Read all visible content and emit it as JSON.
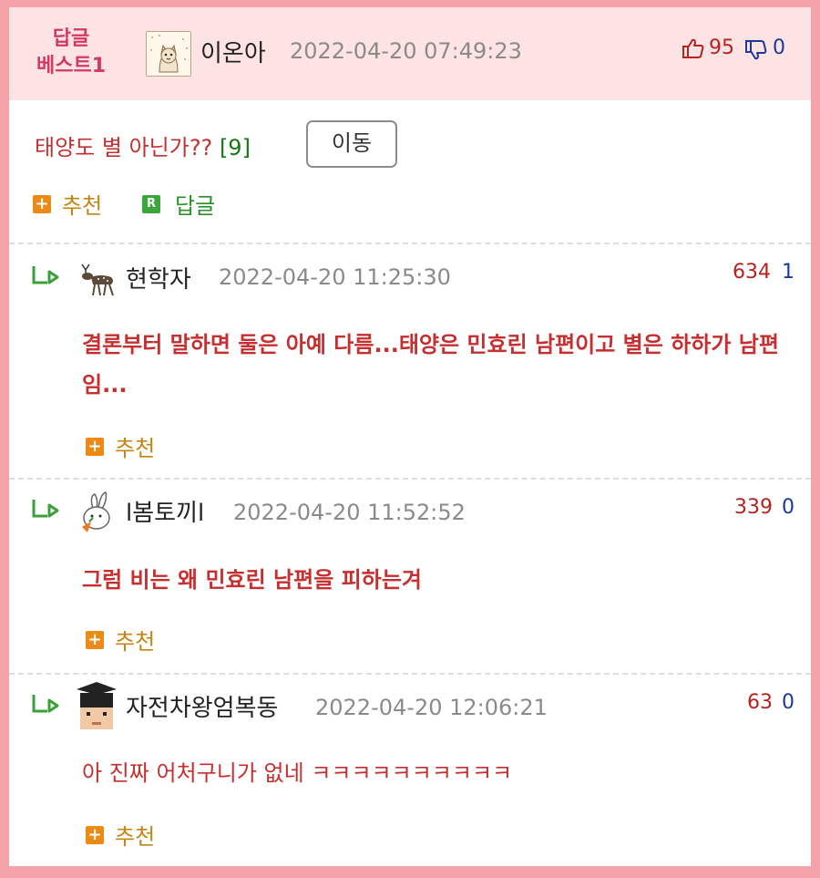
{
  "header": {
    "best_label_line1": "답글",
    "best_label_line2": "베스트1",
    "author": "이온아",
    "date": "2022-04-20 07:49:23",
    "up_count": "95",
    "down_count": "0",
    "title": "태양도 별 아닌가??",
    "reply_count": "[9]",
    "move_label": "이동",
    "recommend_label": "추천",
    "reply_label": "답글"
  },
  "comments": [
    {
      "author": "현학자",
      "date": "2022-04-20 11:25:30",
      "up": "634",
      "down": "1",
      "text": "결론부터 말하면 둘은 아예 다름...태양은 민효린 남편이고 별은 하하가 남편임...",
      "recommend_label": "추천"
    },
    {
      "author": "l봄토끼l",
      "date": "2022-04-20 11:52:52",
      "up": "339",
      "down": "0",
      "text": "그럼 비는 왜 민효린 남편을 피하는겨",
      "recommend_label": "추천"
    },
    {
      "author": "자전차왕엄복동",
      "date": "2022-04-20 12:06:21",
      "up": "63",
      "down": "0",
      "text": "아 진짜 어처구니가 없네 ㅋㅋㅋㅋㅋㅋㅋㅋㅋㅋ",
      "recommend_label": "추천"
    }
  ],
  "colors": {
    "page_border": "#f4a3a8",
    "header_bg": "#fde3e4",
    "best_label": "#d23a62",
    "comment_text": "#c62f2f",
    "up_count": "#b5231f",
    "down_count": "#1b3a9b",
    "recommend": "#ed8a16",
    "reply": "#3ba73b"
  },
  "icons": [
    "thumbs-up-icon",
    "thumbs-down-icon",
    "plus-icon",
    "reply-badge-icon",
    "reply-arrow-icon",
    "avatar"
  ]
}
